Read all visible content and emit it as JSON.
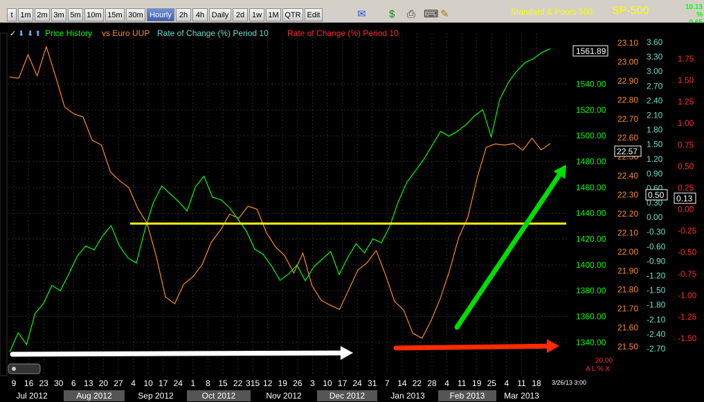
{
  "toolbar": {
    "buttons": [
      "t",
      "1m",
      "2m",
      "3m",
      "5m",
      "10m",
      "15m",
      "30m",
      "Hourly",
      "2h",
      "4h",
      "Daily",
      "2d",
      "1w",
      "1M",
      "QTR",
      "Edit"
    ],
    "active": "Hourly",
    "icons": [
      "mail-icon",
      "dollar-icon",
      "print-icon",
      "keyboard-icon",
      "pencil-icon"
    ]
  },
  "header": {
    "name": "Standard & Poors 500",
    "symbol": "SP-500",
    "change_value": "10.13",
    "change_pct": "% 0.65"
  },
  "colors": {
    "price": "#00ff00",
    "uup": "#ff8c1a",
    "roc_teal": "#66e0cc",
    "roc_red": "#ff2a2a",
    "yellow_line": "#ffff00",
    "arrow_green": "#00dd00",
    "arrow_red": "#ff2a00",
    "arrow_white": "#ffffff"
  },
  "chart_data": {
    "type": "line",
    "legend": [
      {
        "label": "Price History",
        "color": "#00ff00"
      },
      {
        "label": "vs Euro UUP",
        "color": "#ff8c1a"
      },
      {
        "label": "Rate of Change (%) Period 10",
        "color": "#66e0cc"
      },
      {
        "label": "Rate of Change (%) Period 10",
        "color": "#ff2a2a"
      }
    ],
    "price_axis": {
      "ticks": [
        "1540.00",
        "1520.00",
        "1500.00",
        "1480.00",
        "1460.00",
        "1440.00",
        "1420.00",
        "1400.00",
        "1380.00",
        "1360.00",
        "1340.00"
      ],
      "last_label": "1561.89",
      "range": [
        1326,
        1566
      ]
    },
    "uup_axis": {
      "ticks": [
        "23.10",
        "23.00",
        "22.90",
        "22.80",
        "22.70",
        "22.60",
        "22.50",
        "22.40",
        "22.30",
        "22.20",
        "22.10",
        "22.00",
        "21.90",
        "21.80",
        "21.70",
        "21.60",
        "21.50"
      ],
      "last_label": "22.57",
      "range": [
        21.5,
        23.1
      ]
    },
    "roc_teal_axis": {
      "ticks": [
        "3.60",
        "3.30",
        "3.00",
        "2.70",
        "2.40",
        "2.10",
        "1.80",
        "1.50",
        "1.20",
        "0.90",
        "0.60",
        "0.30",
        "0.00",
        "-0.30",
        "-0.60",
        "-0.90",
        "-1.20",
        "-1.50",
        "-1.80",
        "-2.10",
        "-2.40",
        "-2.70"
      ],
      "last_label": "0.50"
    },
    "roc_red_axis": {
      "ticks": [
        "1.75",
        "1.50",
        "1.25",
        "1.00",
        "0.75",
        "0.50",
        "0.25",
        "0.00",
        "-0.25",
        "-0.50",
        "-0.75",
        "-1.00",
        "-1.25",
        "-1.50"
      ],
      "last_label": "0.13"
    },
    "x_day_ticks": [
      "9",
      "16",
      "23",
      "30",
      "6",
      "13",
      "20",
      "27",
      "4",
      "10",
      "17",
      "24",
      "1",
      "8",
      "15",
      "22",
      "315",
      "12",
      "19",
      "26",
      "3",
      "10",
      "17",
      "24",
      "31",
      "7",
      "14",
      "22",
      "28",
      "4",
      "11",
      "19",
      "25",
      "4",
      "11",
      "18"
    ],
    "x_months": [
      "Jul 2012",
      "Aug 2012",
      "Sep 2012",
      "Oct 2012",
      "Nov 2012",
      "Dec 2012",
      "Jan 2013",
      "Feb 2013",
      "Mar 2013"
    ],
    "price_series": [
      1338,
      1352,
      1342,
      1365,
      1372,
      1385,
      1380,
      1392,
      1405,
      1412,
      1408,
      1418,
      1425,
      1420,
      1410,
      1405,
      1430,
      1450,
      1462,
      1455,
      1448,
      1440,
      1458,
      1465,
      1448,
      1445,
      1450,
      1440,
      1430,
      1415,
      1410,
      1400,
      1388,
      1392,
      1398,
      1385,
      1395,
      1400,
      1405,
      1398,
      1410,
      1420,
      1412,
      1422,
      1418,
      1430,
      1448,
      1462,
      1470,
      1478,
      1488,
      1498,
      1505,
      1508,
      1512,
      1518,
      1522,
      1500,
      1528,
      1540,
      1548,
      1554,
      1556,
      1560,
      1562
    ],
    "uup_series": [
      22.95,
      22.92,
      23.02,
      22.95,
      23.08,
      22.9,
      22.78,
      22.72,
      22.68,
      22.6,
      22.55,
      22.45,
      22.38,
      22.32,
      22.25,
      22.15,
      21.95,
      21.78,
      21.72,
      21.8,
      21.88,
      21.92,
      22.08,
      22.12,
      22.18,
      22.2,
      22.24,
      22.2,
      22.12,
      22.02,
      21.95,
      21.9,
      21.98,
      21.85,
      21.75,
      21.7,
      21.72,
      21.8,
      21.88,
      21.96,
      22.0,
      21.85,
      21.75,
      21.68,
      21.6,
      21.55,
      21.62,
      21.78,
      21.9,
      22.05,
      22.2,
      22.38,
      22.52,
      22.58,
      22.55,
      22.6,
      22.54,
      22.58,
      22.56,
      22.57
    ],
    "horizontal_line_price": 1432,
    "date_label": "3/26/13 3:00",
    "bottom_value": "20.00",
    "corner_controls": "A L % X"
  }
}
